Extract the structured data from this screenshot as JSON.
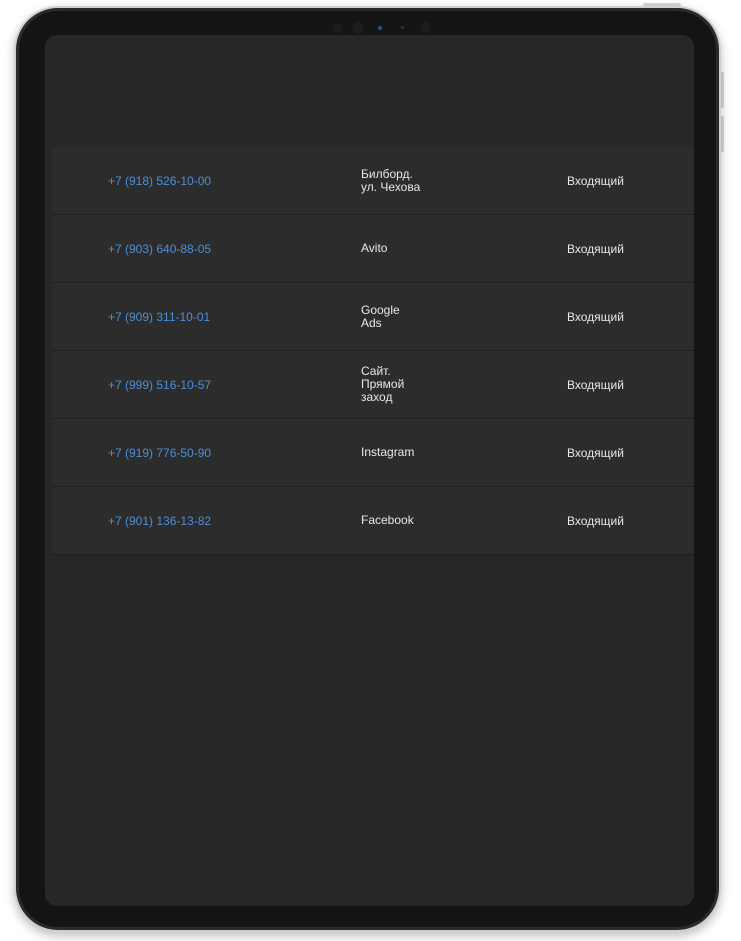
{
  "calls": [
    {
      "phone": "+7 (918) 526-10-00",
      "source": "Билборд.\nул. Чехова",
      "type": "Входящий"
    },
    {
      "phone": "+7 (903) 640-88-05",
      "source": "Avito",
      "type": "Входящий"
    },
    {
      "phone": "+7 (909) 311-10-01",
      "source": "Google\nAds",
      "type": "Входящий"
    },
    {
      "phone": "+7 (999) 516-10-57",
      "source": "Сайт.\nПрямой\nзаход",
      "type": "Входящий"
    },
    {
      "phone": "+7 (919) 776-50-90",
      "source": "Instagram",
      "type": "Входящий"
    },
    {
      "phone": "+7 (901) 136-13-82",
      "source": "Facebook",
      "type": "Входящий"
    }
  ],
  "colors": {
    "phone_link": "#4a90d9",
    "text": "#e8e8e8",
    "row_bg": "#2c2c2c",
    "screen_bg": "#272727"
  }
}
